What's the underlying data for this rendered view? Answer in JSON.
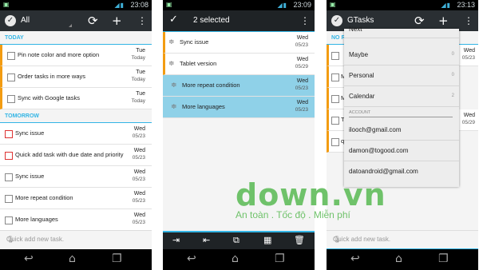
{
  "colors": {
    "accent": "#33b5e5",
    "priority_orange": "#f39c12",
    "priority_red": "#dd3333",
    "actionbar": "#2a2f33",
    "selected": "#8fd1e8",
    "watermark": "#6fc26a"
  },
  "phone1": {
    "time": "23:08",
    "title": "All",
    "sections": {
      "today": "TODAY",
      "tomorrow": "TOMORROW"
    },
    "today_tasks": [
      {
        "title": "Pin note color and more option",
        "d1": "Tue",
        "d2": "Today"
      },
      {
        "title": "Order tasks in more ways",
        "d1": "Tue",
        "d2": "Today"
      },
      {
        "title": "Sync with Google tasks",
        "d1": "Tue",
        "d2": "Today"
      }
    ],
    "tomorrow_tasks": [
      {
        "title": "Sync issue",
        "d1": "Wed",
        "d2": "05/23"
      },
      {
        "title": "Quick add task with due date and priority",
        "d1": "Wed",
        "d2": "05/23"
      },
      {
        "title": "Sync issue",
        "d1": "Wed",
        "d2": "05/23"
      },
      {
        "title": "More repeat condition",
        "d1": "Wed",
        "d2": "05/23"
      },
      {
        "title": "More languages",
        "d1": "Wed",
        "d2": "05/23"
      }
    ],
    "quickadd_placeholder": "Quick add new task."
  },
  "phone2": {
    "time": "23:09",
    "selected_count": "2 selected",
    "tasks": [
      {
        "title": "Sync issue",
        "d1": "Wed",
        "d2": "05/23"
      },
      {
        "title": "Tablet version",
        "d1": "Wed",
        "d2": "05/29"
      },
      {
        "title": "More repeat condition",
        "d1": "Wed",
        "d2": "05/23"
      },
      {
        "title": "More languages",
        "d1": "Wed",
        "d2": "05/23"
      }
    ]
  },
  "phone3": {
    "time": "23:13",
    "title": "GTasks",
    "section_partial": "NO R",
    "menu": {
      "lists": [
        {
          "label": "Next",
          "count": ""
        },
        {
          "label": "Maybe",
          "count": "0"
        },
        {
          "label": "Personal",
          "count": "0"
        },
        {
          "label": "Calendar",
          "count": "2"
        }
      ],
      "account_header": "ACCOUNT",
      "accounts": [
        "ilooch@gmail.com",
        "damon@togood.com",
        "datoandroid@gmail.com"
      ]
    },
    "bg_rows": [
      {
        "ch": "",
        "d1": "Wed",
        "d2": "05/23"
      },
      {
        "ch": "M",
        "d1": "",
        "d2": ""
      },
      {
        "ch": "M",
        "d1": "",
        "d2": ""
      },
      {
        "ch": "T",
        "d1": "Wed",
        "d2": "05/29"
      },
      {
        "ch": "q",
        "d1": "",
        "d2": ""
      }
    ],
    "quickadd_placeholder": "Quick add new task."
  },
  "watermark": {
    "logo": "down.vn",
    "tagline": "An toàn . Tốc độ . Miễn phí"
  }
}
